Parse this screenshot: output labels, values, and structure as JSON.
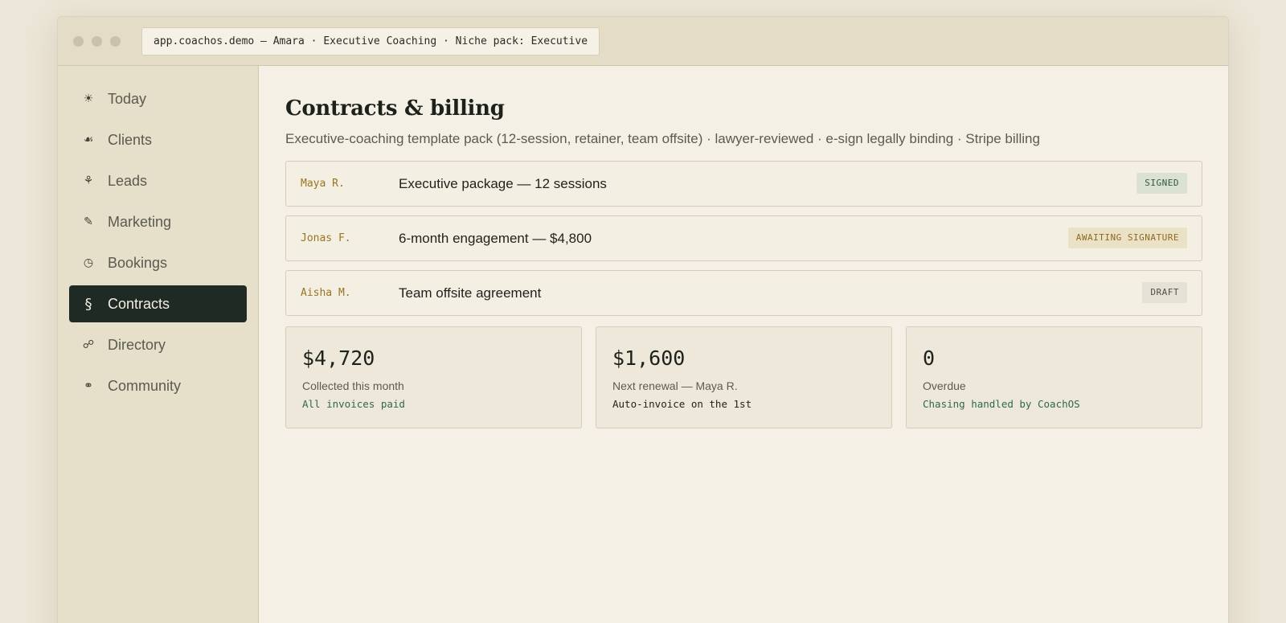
{
  "window": {
    "url": "app.coachos.demo — Amara · Executive Coaching · Niche pack: Executive"
  },
  "sidebar": {
    "items": [
      {
        "label": "Today",
        "icon": "☀"
      },
      {
        "label": "Clients",
        "icon": "☙"
      },
      {
        "label": "Leads",
        "icon": "⚘"
      },
      {
        "label": "Marketing",
        "icon": "✎"
      },
      {
        "label": "Bookings",
        "icon": "◷"
      },
      {
        "label": "Contracts",
        "icon": "§",
        "active": true
      },
      {
        "label": "Directory",
        "icon": "☍"
      },
      {
        "label": "Community",
        "icon": "⚭"
      }
    ]
  },
  "main": {
    "title": "Contracts & billing",
    "subtitle": "Executive-coaching template pack (12-session, retainer, team offsite) · lawyer-reviewed · e-sign legally binding · Stripe billing",
    "contracts": [
      {
        "client": "Maya R.",
        "description": "Executive package — 12 sessions",
        "status": "SIGNED"
      },
      {
        "client": "Jonas F.",
        "description": "6-month engagement — $4,800",
        "status": "AWAITING SIGNATURE"
      },
      {
        "client": "Aisha M.",
        "description": "Team offsite agreement",
        "status": "DRAFT"
      }
    ],
    "stats": [
      {
        "value": "$4,720",
        "label": "Collected this month",
        "note": "All invoices paid"
      },
      {
        "value": "$1,600",
        "label": "Next renewal — Maya R.",
        "note": "Auto-invoice on the 1st"
      },
      {
        "value": "0",
        "label": "Overdue",
        "note": "Chasing handled by CoachOS"
      }
    ]
  },
  "colors": {
    "accent_dark": "#1f2a24",
    "signed": "#2e5a3b",
    "awaiting": "#8d6a1f",
    "client_name": "#9a7421"
  }
}
